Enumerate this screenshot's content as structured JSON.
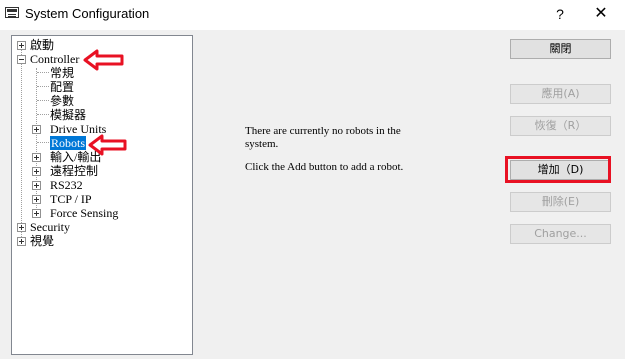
{
  "window": {
    "title": "System Configuration",
    "help_glyph": "?",
    "close_glyph": "✕"
  },
  "tree": [
    {
      "label": "啟動",
      "expander": "plus"
    },
    {
      "label": "Controller",
      "expander": "minus"
    },
    {
      "label": "常規"
    },
    {
      "label": "配置"
    },
    {
      "label": "參數"
    },
    {
      "label": "模擬器"
    },
    {
      "label": "Drive Units",
      "expander": "plus"
    },
    {
      "label": "Robots",
      "selected": true
    },
    {
      "label": "輸入/輸出",
      "expander": "plus"
    },
    {
      "label": "遠程控制",
      "expander": "plus"
    },
    {
      "label": "RS232",
      "expander": "plus"
    },
    {
      "label": "TCP / IP",
      "expander": "plus"
    },
    {
      "label": "Force Sensing",
      "expander": "plus"
    },
    {
      "label": "Security",
      "expander": "plus"
    },
    {
      "label": "視覺",
      "expander": "plus"
    }
  ],
  "message": {
    "line1": "There are currently no robots in the",
    "line2": "system.",
    "line3": "Click the Add button to add a robot."
  },
  "buttons": {
    "close": "關閉",
    "apply": "應用(A)",
    "restore": "恢復（R）",
    "add": "增加（D)",
    "delete": "刪除(E)",
    "change": "Change..."
  },
  "colors": {
    "annotation_red": "#e81123",
    "selection_blue": "#0078d7"
  }
}
